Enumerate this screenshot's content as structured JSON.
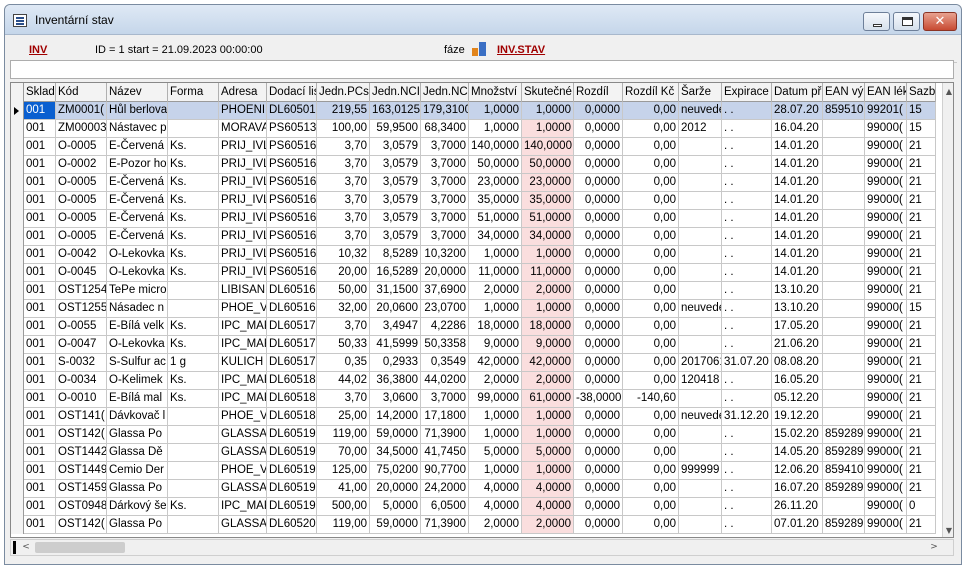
{
  "window": {
    "title": "Inventární stav",
    "controls": {
      "minimize_icon": "minimize-icon",
      "maximize_icon": "maximize-icon",
      "close_label": "✕"
    }
  },
  "infobar": {
    "inv_link": "INV",
    "id_text": "ID = 1   start = 21.09.2023 00:00:00",
    "faze_label": "fáze",
    "faze_icon": "phase-chart-icon",
    "invstav_link": "INV.STAV"
  },
  "filter": {
    "value": ""
  },
  "table": {
    "columns": [
      {
        "key": "sklad",
        "label": "Sklad",
        "num": false
      },
      {
        "key": "kod",
        "label": "Kód",
        "num": false
      },
      {
        "key": "nazev",
        "label": "Název",
        "num": false
      },
      {
        "key": "forma",
        "label": "Forma",
        "num": false
      },
      {
        "key": "adresa",
        "label": "Adresa",
        "num": false
      },
      {
        "key": "dodaci",
        "label": "Dodací lis",
        "num": false
      },
      {
        "key": "jpc",
        "label": "Jedn.PCs",
        "num": true
      },
      {
        "key": "jnc",
        "label": "Jedn.NCI",
        "num": true
      },
      {
        "key": "jnc2",
        "label": "Jedn.NC!",
        "num": true
      },
      {
        "key": "mnoz",
        "label": "Množství",
        "num": true
      },
      {
        "key": "skut",
        "label": "Skutečné",
        "num": true
      },
      {
        "key": "rozdil",
        "label": "Rozdíl",
        "num": true
      },
      {
        "key": "rozdilkc",
        "label": "Rozdíl Kč",
        "num": true
      },
      {
        "key": "sarze",
        "label": "Šarže",
        "num": false
      },
      {
        "key": "expirace",
        "label": "Expirace",
        "num": false
      },
      {
        "key": "datum",
        "label": "Datum př",
        "num": false
      },
      {
        "key": "ean1",
        "label": "EAN výr",
        "num": false
      },
      {
        "key": "ean2",
        "label": "EAN lék",
        "num": false
      },
      {
        "key": "sazba",
        "label": "Sazb",
        "num": false
      }
    ],
    "rows": [
      [
        "001",
        "ZM0001(",
        "Hůl berlova",
        "",
        "PHOENI:",
        "DL60501",
        "219,55",
        "163,0125",
        "179,3100",
        "1,0000",
        "1,0000",
        "0,0000",
        "0,00",
        "neuvede",
        ". .",
        "28.07.20",
        "859510",
        "99201(",
        "15"
      ],
      [
        "001",
        "ZM00003",
        "Nástavec p",
        "",
        "MORAVA",
        "PS60513",
        "100,00",
        "59,9500",
        "68,3400",
        "1,0000",
        "1,0000",
        "0,0000",
        "0,00",
        "2012",
        ". .",
        "16.04.20",
        "",
        "99000(",
        "15"
      ],
      [
        "001",
        "O-0005",
        "E-Červená",
        "Ks.",
        "PRIJ_IVL",
        "PS60516",
        "3,70",
        "3,0579",
        "3,7000",
        "140,0000",
        "140,0000",
        "0,0000",
        "0,00",
        "",
        ". .",
        "14.01.20",
        "",
        "99000(",
        "21"
      ],
      [
        "001",
        "O-0002",
        "E-Pozor ho",
        "Ks.",
        "PRIJ_IVL",
        "PS60516",
        "3,70",
        "3,0579",
        "3,7000",
        "50,0000",
        "50,0000",
        "0,0000",
        "0,00",
        "",
        ". .",
        "14.01.20",
        "",
        "99000(",
        "21"
      ],
      [
        "001",
        "O-0005",
        "E-Červená",
        "Ks.",
        "PRIJ_IVL",
        "PS60516",
        "3,70",
        "3,0579",
        "3,7000",
        "23,0000",
        "23,0000",
        "0,0000",
        "0,00",
        "",
        ". .",
        "14.01.20",
        "",
        "99000(",
        "21"
      ],
      [
        "001",
        "O-0005",
        "E-Červená",
        "Ks.",
        "PRIJ_IVL",
        "PS60516",
        "3,70",
        "3,0579",
        "3,7000",
        "35,0000",
        "35,0000",
        "0,0000",
        "0,00",
        "",
        ". .",
        "14.01.20",
        "",
        "99000(",
        "21"
      ],
      [
        "001",
        "O-0005",
        "E-Červená",
        "Ks.",
        "PRIJ_IVL",
        "PS60516",
        "3,70",
        "3,0579",
        "3,7000",
        "51,0000",
        "51,0000",
        "0,0000",
        "0,00",
        "",
        ". .",
        "14.01.20",
        "",
        "99000(",
        "21"
      ],
      [
        "001",
        "O-0005",
        "E-Červená",
        "Ks.",
        "PRIJ_IVL",
        "PS60516",
        "3,70",
        "3,0579",
        "3,7000",
        "34,0000",
        "34,0000",
        "0,0000",
        "0,00",
        "",
        ". .",
        "14.01.20",
        "",
        "99000(",
        "21"
      ],
      [
        "001",
        "O-0042",
        "O-Lekovka",
        "Ks.",
        "PRIJ_IVL",
        "PS60516",
        "10,32",
        "8,5289",
        "10,3200",
        "1,0000",
        "1,0000",
        "0,0000",
        "0,00",
        "",
        ". .",
        "14.01.20",
        "",
        "99000(",
        "21"
      ],
      [
        "001",
        "O-0045",
        "O-Lekovka",
        "Ks.",
        "PRIJ_IVL",
        "PS60516",
        "20,00",
        "16,5289",
        "20,0000",
        "11,0000",
        "11,0000",
        "0,0000",
        "0,00",
        "",
        ". .",
        "14.01.20",
        "",
        "99000(",
        "21"
      ],
      [
        "001",
        "OST1254",
        "TePe micro",
        "",
        "LIBISAN",
        "DL60516",
        "50,00",
        "31,1500",
        "37,6900",
        "2,0000",
        "2,0000",
        "0,0000",
        "0,00",
        "",
        ". .",
        "13.10.20",
        "",
        "99000(",
        "21"
      ],
      [
        "001",
        "OST1255",
        "Násadec n",
        "",
        "PHOE_V",
        "DL60516",
        "32,00",
        "20,0600",
        "23,0700",
        "1,0000",
        "1,0000",
        "0,0000",
        "0,00",
        "neuvede",
        ". .",
        "13.10.20",
        "",
        "99000(",
        "15"
      ],
      [
        "001",
        "O-0055",
        "E-Bílá velk",
        "Ks.",
        "IPC_MAF",
        "DL60517",
        "3,70",
        "3,4947",
        "4,2286",
        "18,0000",
        "18,0000",
        "0,0000",
        "0,00",
        "",
        ". .",
        "17.05.20",
        "",
        "99000(",
        "21"
      ],
      [
        "001",
        "O-0047",
        "O-Lekovka",
        "Ks.",
        "IPC_MAF",
        "DL60517",
        "50,33",
        "41,5999",
        "50,3358",
        "9,0000",
        "9,0000",
        "0,0000",
        "0,00",
        "",
        ". .",
        "21.06.20",
        "",
        "99000(",
        "21"
      ],
      [
        "001",
        "S-0032",
        "S-Sulfur ac",
        "1 g",
        "KULICH",
        "DL60517",
        "0,35",
        "0,2933",
        "0,3549",
        "42,0000",
        "42,0000",
        "0,0000",
        "0,00",
        "2017061",
        "31.07.20",
        "08.08.20",
        "",
        "99000(",
        "21"
      ],
      [
        "001",
        "O-0034",
        "O-Kelimek",
        "Ks.",
        "IPC_MAF",
        "DL60518",
        "44,02",
        "36,3800",
        "44,0200",
        "2,0000",
        "2,0000",
        "0,0000",
        "0,00",
        "120418",
        ". .",
        "16.05.20",
        "",
        "99000(",
        "21"
      ],
      [
        "001",
        "O-0010",
        "E-Bílá mal",
        "Ks.",
        "IPC_MAF",
        "DL60518",
        "3,70",
        "3,0600",
        "3,7000",
        "99,0000",
        "61,0000",
        "-38,0000",
        "-140,60",
        "",
        ". .",
        "05.12.20",
        "",
        "99000(",
        "21"
      ],
      [
        "001",
        "OST141(",
        "Dávkovač l",
        "",
        "PHOE_V",
        "DL60518",
        "25,00",
        "14,2000",
        "17,1800",
        "1,0000",
        "1,0000",
        "0,0000",
        "0,00",
        "neuvede",
        "31.12.20",
        "19.12.20",
        "",
        "99000(",
        "21"
      ],
      [
        "001",
        "OST142(",
        "Glassa Po",
        "",
        "GLASSA",
        "DL60519",
        "119,00",
        "59,0000",
        "71,3900",
        "1,0000",
        "1,0000",
        "0,0000",
        "0,00",
        "",
        ". .",
        "15.02.20",
        "859289",
        "99000(",
        "21"
      ],
      [
        "001",
        "OST1442",
        "Glassa Dě",
        "",
        "GLASSA",
        "DL60519",
        "70,00",
        "34,5000",
        "41,7450",
        "5,0000",
        "5,0000",
        "0,0000",
        "0,00",
        "",
        ". .",
        "14.05.20",
        "859289",
        "99000(",
        "21"
      ],
      [
        "001",
        "OST1449",
        "Cemio Der",
        "",
        "PHOE_V",
        "DL60519",
        "125,00",
        "75,0200",
        "90,7700",
        "1,0000",
        "1,0000",
        "0,0000",
        "0,00",
        "999999",
        ". .",
        "12.06.20",
        "859410",
        "99000(",
        "21"
      ],
      [
        "001",
        "OST1459",
        "Glassa Po",
        "",
        "GLASSA",
        "DL60519",
        "41,00",
        "20,0000",
        "24,2000",
        "4,0000",
        "4,0000",
        "0,0000",
        "0,00",
        "",
        ". .",
        "16.07.20",
        "859289",
        "99000(",
        "21"
      ],
      [
        "001",
        "OST0948",
        "Dárkový še",
        "Ks.",
        "IPC_MAF",
        "DL60519",
        "500,00",
        "5,0000",
        "6,0500",
        "4,0000",
        "4,0000",
        "0,0000",
        "0,00",
        "",
        ". .",
        "26.11.20",
        "",
        "99000(",
        "0"
      ],
      [
        "001",
        "OST142(",
        "Glassa Po",
        "",
        "GLASSA",
        "DL60520",
        "119,00",
        "59,0000",
        "71,3900",
        "2,0000",
        "2,0000",
        "0,0000",
        "0,00",
        "",
        ". .",
        "07.01.20",
        "859289",
        "99000(",
        "21"
      ]
    ]
  },
  "scroll": {
    "up": "▲",
    "down": "▼",
    "left": "<",
    "right": ">"
  }
}
